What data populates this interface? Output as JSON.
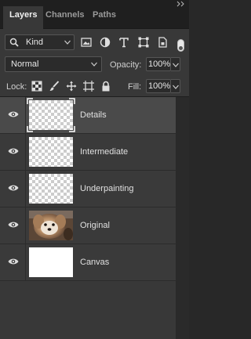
{
  "tabs": [
    {
      "label": "Layers",
      "active": true
    },
    {
      "label": "Channels",
      "active": false
    },
    {
      "label": "Paths",
      "active": false
    }
  ],
  "filter": {
    "kind_label": "Kind",
    "icons": [
      "pixel-filter-icon",
      "adjustment-filter-icon",
      "type-filter-icon",
      "shape-filter-icon",
      "smart-object-filter-icon"
    ]
  },
  "blend": {
    "mode": "Normal",
    "opacity_label": "Opacity:",
    "opacity_value": "100%"
  },
  "lock": {
    "label": "Lock:",
    "fill_label": "Fill:",
    "fill_value": "100%"
  },
  "layers": [
    {
      "name": "Details",
      "thumb": "transparent",
      "selected": true
    },
    {
      "name": "Intermediate",
      "thumb": "transparent",
      "selected": false
    },
    {
      "name": "Underpainting",
      "thumb": "transparent",
      "selected": false
    },
    {
      "name": "Original",
      "thumb": "photo",
      "selected": false
    },
    {
      "name": "Canvas",
      "thumb": "white",
      "selected": false
    }
  ],
  "colors": {
    "panel_bg": "#383838",
    "tabbar_bg": "#1f1f1f",
    "selected_layer_bg": "#4a4a4a"
  }
}
